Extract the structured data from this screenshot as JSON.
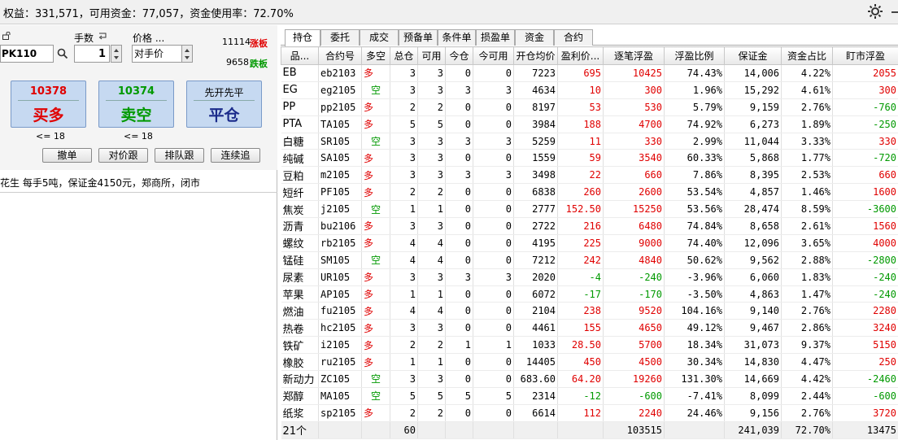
{
  "summary": "权益：331,571，可用资金：77,057，资金使用率：72.70%",
  "order": {
    "qty_label": "手数",
    "price_label": "价格 ...",
    "code_value": "PK110",
    "qty_value": "1",
    "price_value": "对手价",
    "limit_up": "11114",
    "limit_up_tag": "涨板",
    "limit_down": "9658",
    "limit_down_tag": "跌板",
    "buy_price": "10378",
    "buy_label": "买多",
    "sell_price": "10374",
    "sell_label": "卖空",
    "close_mode": "先开先平",
    "close_label": "平仓",
    "buy_note": "<= 18",
    "sell_note": "<= 18",
    "btn_cancel": "撤单",
    "btn_counter": "对价跟",
    "btn_queue": "排队跟",
    "btn_chase": "连续追"
  },
  "info_line": "花生 每手5吨，保证金4150元，郑商所，闭市",
  "tabs": [
    "持仓",
    "委托",
    "成交",
    "预备单",
    "条件单",
    "损盈单",
    "资金",
    "合约"
  ],
  "columns": [
    "品...",
    "合约号",
    "多空",
    "总仓",
    "可用",
    "今仓",
    "今可用",
    "开仓均价",
    "盈利价...",
    "逐笔浮盈",
    "浮盈比例",
    "保证金",
    "资金占比",
    "盯市浮盈"
  ],
  "rows": [
    {
      "name": "EB",
      "code": "eb2103",
      "dir": "多",
      "total": "3",
      "avail": "3",
      "today": "0",
      "today_avail": "0",
      "avg": "7223",
      "pl_pts": "695",
      "pl": "10425",
      "ratio": "74.43%",
      "margin": "14,006",
      "share": "4.22%",
      "mtm": "2055"
    },
    {
      "name": "EG",
      "code": "eg2105",
      "dir": "空",
      "total": "3",
      "avail": "3",
      "today": "3",
      "today_avail": "3",
      "avg": "4634",
      "pl_pts": "10",
      "pl": "300",
      "ratio": "1.96%",
      "margin": "15,292",
      "share": "4.61%",
      "mtm": "300"
    },
    {
      "name": "PP",
      "code": "pp2105",
      "dir": "多",
      "total": "2",
      "avail": "2",
      "today": "0",
      "today_avail": "0",
      "avg": "8197",
      "pl_pts": "53",
      "pl": "530",
      "ratio": "5.79%",
      "margin": "9,159",
      "share": "2.76%",
      "mtm": "-760"
    },
    {
      "name": "PTA",
      "code": "TA105",
      "dir": "多",
      "total": "5",
      "avail": "5",
      "today": "0",
      "today_avail": "0",
      "avg": "3984",
      "pl_pts": "188",
      "pl": "4700",
      "ratio": "74.92%",
      "margin": "6,273",
      "share": "1.89%",
      "mtm": "-250"
    },
    {
      "name": "白糖",
      "code": "SR105",
      "dir": "空",
      "total": "3",
      "avail": "3",
      "today": "3",
      "today_avail": "3",
      "avg": "5259",
      "pl_pts": "11",
      "pl": "330",
      "ratio": "2.99%",
      "margin": "11,044",
      "share": "3.33%",
      "mtm": "330"
    },
    {
      "name": "纯碱",
      "code": "SA105",
      "dir": "多",
      "total": "3",
      "avail": "3",
      "today": "0",
      "today_avail": "0",
      "avg": "1559",
      "pl_pts": "59",
      "pl": "3540",
      "ratio": "60.33%",
      "margin": "5,868",
      "share": "1.77%",
      "mtm": "-720"
    },
    {
      "name": "豆粕",
      "code": "m2105",
      "dir": "多",
      "total": "3",
      "avail": "3",
      "today": "3",
      "today_avail": "3",
      "avg": "3498",
      "pl_pts": "22",
      "pl": "660",
      "ratio": "7.86%",
      "margin": "8,395",
      "share": "2.53%",
      "mtm": "660"
    },
    {
      "name": "短纤",
      "code": "PF105",
      "dir": "多",
      "total": "2",
      "avail": "2",
      "today": "0",
      "today_avail": "0",
      "avg": "6838",
      "pl_pts": "260",
      "pl": "2600",
      "ratio": "53.54%",
      "margin": "4,857",
      "share": "1.46%",
      "mtm": "1600"
    },
    {
      "name": "焦炭",
      "code": "j2105",
      "dir": "空",
      "total": "1",
      "avail": "1",
      "today": "0",
      "today_avail": "0",
      "avg": "2777",
      "pl_pts": "152.50",
      "pl": "15250",
      "ratio": "53.56%",
      "margin": "28,474",
      "share": "8.59%",
      "mtm": "-3600"
    },
    {
      "name": "沥青",
      "code": "bu2106",
      "dir": "多",
      "total": "3",
      "avail": "3",
      "today": "0",
      "today_avail": "0",
      "avg": "2722",
      "pl_pts": "216",
      "pl": "6480",
      "ratio": "74.84%",
      "margin": "8,658",
      "share": "2.61%",
      "mtm": "1560"
    },
    {
      "name": "螺纹",
      "code": "rb2105",
      "dir": "多",
      "total": "4",
      "avail": "4",
      "today": "0",
      "today_avail": "0",
      "avg": "4195",
      "pl_pts": "225",
      "pl": "9000",
      "ratio": "74.40%",
      "margin": "12,096",
      "share": "3.65%",
      "mtm": "4000"
    },
    {
      "name": "锰硅",
      "code": "SM105",
      "dir": "空",
      "total": "4",
      "avail": "4",
      "today": "0",
      "today_avail": "0",
      "avg": "7212",
      "pl_pts": "242",
      "pl": "4840",
      "ratio": "50.62%",
      "margin": "9,562",
      "share": "2.88%",
      "mtm": "-2800"
    },
    {
      "name": "尿素",
      "code": "UR105",
      "dir": "多",
      "total": "3",
      "avail": "3",
      "today": "3",
      "today_avail": "3",
      "avg": "2020",
      "pl_pts": "-4",
      "pl": "-240",
      "ratio": "-3.96%",
      "margin": "6,060",
      "share": "1.83%",
      "mtm": "-240"
    },
    {
      "name": "苹果",
      "code": "AP105",
      "dir": "多",
      "total": "1",
      "avail": "1",
      "today": "0",
      "today_avail": "0",
      "avg": "6072",
      "pl_pts": "-17",
      "pl": "-170",
      "ratio": "-3.50%",
      "margin": "4,863",
      "share": "1.47%",
      "mtm": "-240"
    },
    {
      "name": "燃油",
      "code": "fu2105",
      "dir": "多",
      "total": "4",
      "avail": "4",
      "today": "0",
      "today_avail": "0",
      "avg": "2104",
      "pl_pts": "238",
      "pl": "9520",
      "ratio": "104.16%",
      "margin": "9,140",
      "share": "2.76%",
      "mtm": "2280"
    },
    {
      "name": "热卷",
      "code": "hc2105",
      "dir": "多",
      "total": "3",
      "avail": "3",
      "today": "0",
      "today_avail": "0",
      "avg": "4461",
      "pl_pts": "155",
      "pl": "4650",
      "ratio": "49.12%",
      "margin": "9,467",
      "share": "2.86%",
      "mtm": "3240"
    },
    {
      "name": "铁矿",
      "code": "i2105",
      "dir": "多",
      "total": "2",
      "avail": "2",
      "today": "1",
      "today_avail": "1",
      "avg": "1033",
      "pl_pts": "28.50",
      "pl": "5700",
      "ratio": "18.34%",
      "margin": "31,073",
      "share": "9.37%",
      "mtm": "5150"
    },
    {
      "name": "橡胶",
      "code": "ru2105",
      "dir": "多",
      "total": "1",
      "avail": "1",
      "today": "0",
      "today_avail": "0",
      "avg": "14405",
      "pl_pts": "450",
      "pl": "4500",
      "ratio": "30.34%",
      "margin": "14,830",
      "share": "4.47%",
      "mtm": "250"
    },
    {
      "name": "新动力",
      "code": "ZC105",
      "dir": "空",
      "total": "3",
      "avail": "3",
      "today": "0",
      "today_avail": "0",
      "avg": "683.60",
      "pl_pts": "64.20",
      "pl": "19260",
      "ratio": "131.30%",
      "margin": "14,669",
      "share": "4.42%",
      "mtm": "-2460"
    },
    {
      "name": "郑醇",
      "code": "MA105",
      "dir": "空",
      "total": "5",
      "avail": "5",
      "today": "5",
      "today_avail": "5",
      "avg": "2314",
      "pl_pts": "-12",
      "pl": "-600",
      "ratio": "-7.41%",
      "margin": "8,099",
      "share": "2.44%",
      "mtm": "-600"
    },
    {
      "name": "纸浆",
      "code": "sp2105",
      "dir": "多",
      "total": "2",
      "avail": "2",
      "today": "0",
      "today_avail": "0",
      "avg": "6614",
      "pl_pts": "112",
      "pl": "2240",
      "ratio": "24.46%",
      "margin": "9,156",
      "share": "2.76%",
      "mtm": "3720"
    }
  ],
  "totals": {
    "name": "21个",
    "total": "60",
    "pl": "103515",
    "margin": "241,039",
    "share": "72.70%",
    "mtm": "13475"
  },
  "colors": {
    "profit": "#e00000",
    "loss": "#009900",
    "button_bg": "#c6d9f1"
  }
}
